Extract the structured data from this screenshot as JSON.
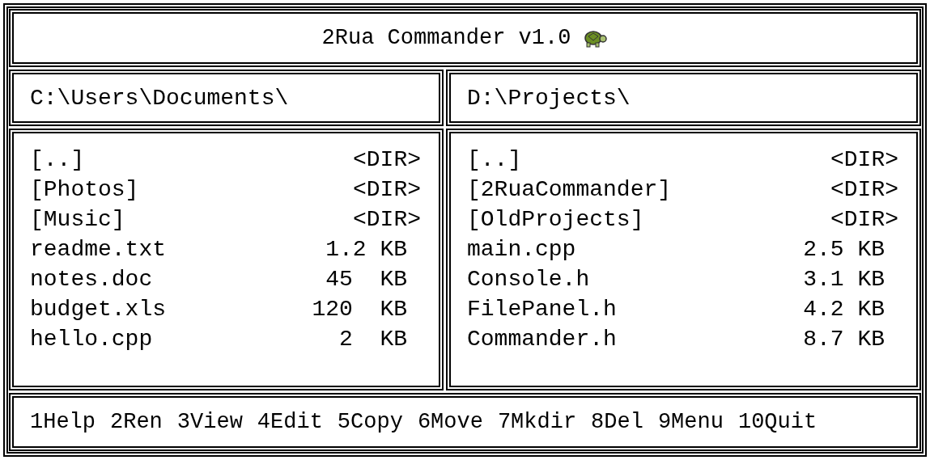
{
  "window": {
    "title": "2Rua Commander v1.0"
  },
  "panels": [
    {
      "path": "C:\\Users\\Documents\\",
      "items": [
        {
          "name": "[..]",
          "size": "<DIR>",
          "kind": "dir"
        },
        {
          "name": "[Photos]",
          "size": "<DIR>",
          "kind": "dir"
        },
        {
          "name": "[Music]",
          "size": "<DIR>",
          "kind": "dir"
        },
        {
          "name": "readme.txt",
          "size": "1.2 KB",
          "kind": "file"
        },
        {
          "name": "notes.doc",
          "size": "45  KB",
          "kind": "file"
        },
        {
          "name": "budget.xls",
          "size": "120  KB",
          "kind": "file"
        },
        {
          "name": "hello.cpp",
          "size": "2  KB",
          "kind": "file"
        }
      ]
    },
    {
      "path": "D:\\Projects\\",
      "items": [
        {
          "name": "[..]",
          "size": "<DIR>",
          "kind": "dir"
        },
        {
          "name": "[2RuaCommander]",
          "size": "<DIR>",
          "kind": "dir"
        },
        {
          "name": "[OldProjects]",
          "size": "<DIR>",
          "kind": "dir"
        },
        {
          "name": "main.cpp",
          "size": "2.5 KB",
          "kind": "file"
        },
        {
          "name": "Console.h",
          "size": "3.1 KB",
          "kind": "file"
        },
        {
          "name": "FilePanel.h",
          "size": "4.2 KB",
          "kind": "file"
        },
        {
          "name": "Commander.h",
          "size": "8.7 KB",
          "kind": "file"
        }
      ]
    }
  ],
  "function_keys": [
    "1Help",
    "2Ren",
    "3View",
    "4Edit",
    "5Copy",
    "6Move",
    "7Mkdir",
    "8Del",
    "9Menu",
    "10Quit"
  ]
}
